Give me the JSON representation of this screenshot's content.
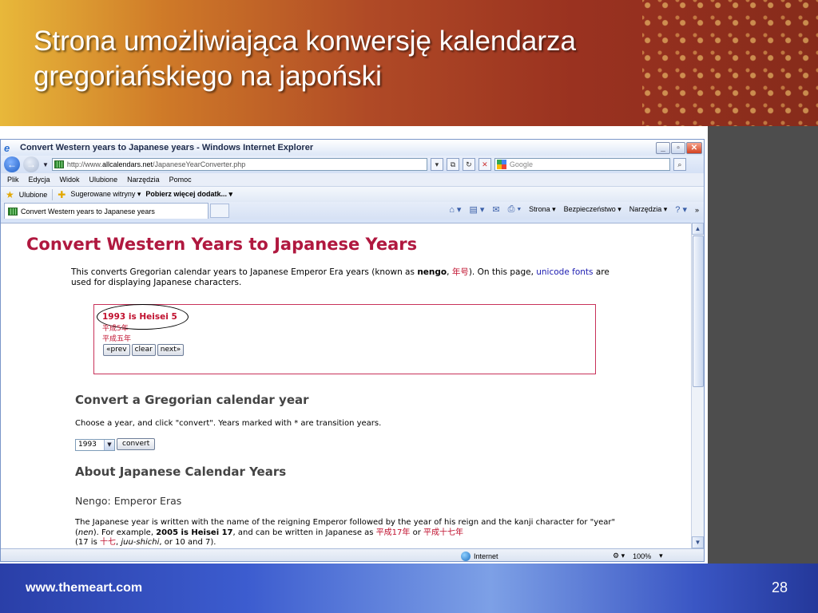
{
  "slide": {
    "title": "Strona umożliwiająca konwersję kalendarza gregoriańskiego na japoński",
    "footer_url": "www.themeart.com",
    "page_number": "28"
  },
  "browser": {
    "window_title": "Convert Western years to Japanese years - Windows Internet Explorer",
    "url_prefix": "http://www.",
    "url_domain": "allcalendars.net",
    "url_path": "/JapaneseYearConverter.php",
    "search_placeholder": "Google",
    "menu": [
      "Plik",
      "Edycja",
      "Widok",
      "Ulubione",
      "Narzędzia",
      "Pomoc"
    ],
    "favorites": {
      "label": "Ulubione",
      "suggested": "Sugerowane witryny ▾",
      "addons": "Pobierz więcej dodatk... ▾"
    },
    "tab_title": "Convert Western years to Japanese years",
    "commands": {
      "page": "Strona ▾",
      "safety": "Bezpieczeństwo ▾",
      "tools": "Narzędzia ▾",
      "more": "»"
    },
    "status": {
      "zone": "Internet",
      "zoom": "100%"
    }
  },
  "page": {
    "heading": "Convert Western Years to Japanese Years",
    "intro_1": "This converts Gregorian calendar years to Japanese Emperor Era years (known as ",
    "intro_nengo": "nengo",
    "intro_2": ", ",
    "intro_kanji": "年号",
    "intro_3": "). On this page, ",
    "intro_link": "unicode fonts",
    "intro_4": " are used for displaying Japanese characters.",
    "result": {
      "main": "1993 is Heisei 5",
      "kanji_numeric": "平成5年",
      "kanji_full": "平成五年",
      "buttons": {
        "prev": "«prev",
        "clear": "clear",
        "next": "next»"
      }
    },
    "convert_section": {
      "heading": "Convert a Gregorian calendar year",
      "instructions": "Choose a year, and click \"convert\". Years marked with * are transition years.",
      "selected_year": "1993",
      "button": "convert"
    },
    "about": {
      "heading": "About Japanese Calendar Years",
      "subheading": "Nengo: Emperor Eras",
      "p1": "The Japanese year is written with the name of the reigning Emperor followed by the year of his reign and the kanji character for \"year\" (",
      "p1_nen": "nen",
      "p1_b": "). For example, ",
      "p1_example": "2005 is Heisei 17",
      "p1_c": ", and can be written in Japanese as ",
      "p1_k1": "平成17年",
      "p1_or": " or ",
      "p1_k2": "平成十七年",
      "p2_a": "(17 is ",
      "p2_k": "十七",
      "p2_b": ", ",
      "p2_it": "juu-shichi",
      "p2_c": ", or 10 and 7)."
    }
  },
  "colors": {
    "heading_red": "#b0183f",
    "result_red": "#c0102e",
    "link_blue": "#1a1ab0"
  }
}
